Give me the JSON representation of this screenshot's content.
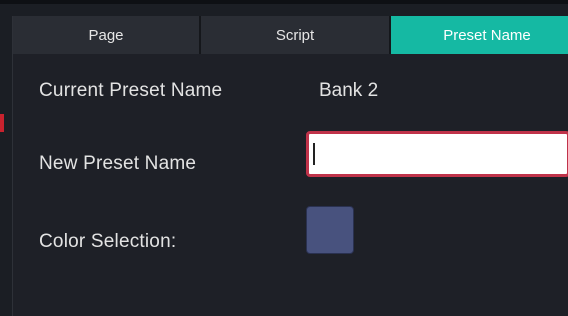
{
  "tabs": {
    "page": "Page",
    "script": "Script",
    "preset_name": "Preset Name"
  },
  "form": {
    "current_label": "Current Preset Name",
    "current_value": "Bank 2",
    "new_label": "New Preset Name",
    "new_value": "",
    "color_label": "Color Selection:",
    "selected_color": "#48527e"
  },
  "colors": {
    "active_tab": "#15b9a3",
    "input_border": "#c0334a",
    "background": "#1e2027"
  }
}
